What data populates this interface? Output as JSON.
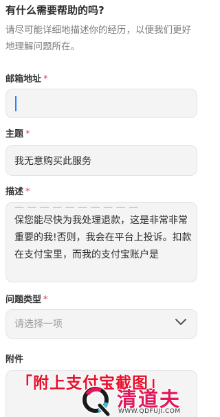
{
  "header": {
    "title": "有什么需要帮助的吗?",
    "description": "请尽可能详细地描述你的经历，以便我们更好地理解问题所在。"
  },
  "form": {
    "email": {
      "label": "邮箱地址",
      "required_mark": "*",
      "value": ""
    },
    "subject": {
      "label": "主题",
      "required_mark": "*",
      "value": "我无意购买此服务"
    },
    "description": {
      "label": "描述",
      "required_mark": "*",
      "value": "保您能尽快为我处理退款，这是非常非常重要的我!否则，我会在平台上投诉。扣款在支付宝里，而我的支付宝账户是"
    },
    "issue_type": {
      "label": "问题类型",
      "required_mark": "*",
      "placeholder": "请选择一项"
    },
    "attachments": {
      "label": "附件"
    }
  },
  "overlay": {
    "caption": "「附上支付宝截图」"
  },
  "watermark": {
    "brand": "清道夫",
    "url": "WWW.QDFUJI.COM"
  },
  "colors": {
    "required": "#e0404b",
    "caret": "#2d7ff9",
    "overlay_red": "#e8112d",
    "brand_pink": "#e0175a"
  },
  "icons": {
    "dropdown": "chevron-down-icon",
    "logo": "q-logo-icon"
  }
}
